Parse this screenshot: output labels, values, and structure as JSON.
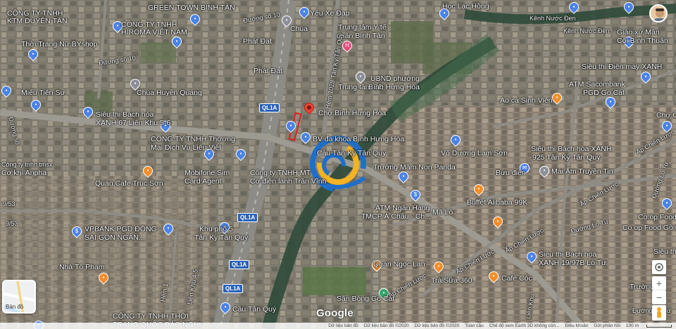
{
  "labels": {
    "green_town": "GREEN TOWN BÌNH TÂN",
    "cty_tnhh": "CÔNG TY TNHH",
    "ktm_duyen_tan": "KTM DUYÊN TÂN",
    "cty_tnhh_2": "CÔNG TY TNHH",
    "hiroma": "HIROMA VIỆT NAM",
    "thoi_trang": "Thời Trang Nữ BYshop",
    "duong_so_10a": "Đường số 10",
    "duong_so_10b": "Đường số 10",
    "yeu_xe_dap": "Yêu Xe Đạp",
    "chua": "Chùa",
    "trung_tam_yte": "Trung tâm Y tế",
    "quan_binh_tan": "quận Bình Tân",
    "phat_dat_1": "Phát Đạt",
    "phat_dat_2": "Phát Đạt",
    "hem_1028": "Hẻm 1028 Tân Kỳ Tân Quý",
    "trung_tam_bd": "Trung tâm BD",
    "ubnd": "UBND phường",
    "binh_hung_hoa": "Bình Hưng Hòa",
    "hoc_lac_hong": "Học Lạc Hồng",
    "kenh_nuoc_den_1": "Kênh Nước Đen",
    "kenh_nuoc_den_2": "Kênh Nước Đen",
    "giao_xu": "Giáo xứ Mân",
    "coi_binh_thuan": "Côi Bình Thuận",
    "mieu_tien_su": "Miếu Tiên Sư",
    "chua_huyen_quang": "Chùa Huyền Quang",
    "sieu_thi_dien_may": "Siêu thị Điện máy XANH",
    "atm_sacombank": "ATM Sacombank",
    "pgd_go_cat": "PGD Gò Cát",
    "ao_ca": "Ao cá Sinh Viên",
    "cho_binh_hung_hoa": "Chợ Bình Hưng Hòa",
    "sieu_thi_bhx_1": "Siêu thị Bách hóa",
    "xanh_67": "XANH 67 Liên Khu 5-6",
    "bv_binh_hung_hoa": "BV đa khoa Bình Hưng Hòa",
    "cau_tan_ky": "Cầu Tân Kỳ Tân Quý",
    "cty_thuong_mai": "CÔNG TY TNHH Thương",
    "mai_dich_vu": "Mại Dịch Vụ Liêu Việt",
    "vo_duong_lam_son": "Võ Dương Lam Sơn",
    "sieu_thi_bhx_2": "Siêu thị Bách hóa XANH",
    "bhx_925": "925 Tân Kỳ Tân Quý",
    "cty_tmsx": "Công ty tnhh tmsx",
    "co_khi_anpha": "Cơ khí Anpha",
    "truong_mam_non": "Trường Mầm Non Panda",
    "buu_dien": "Bưu điện",
    "mai_am": "Mái Ấm Truyền Tin",
    "mobifone": "Mobifone Sim",
    "card_agent": "Card Agent",
    "cty_mt": "Công ty TNHH MT",
    "co_dien_lanh": "Cơ điện lạnh Trần Vĩnh",
    "quan_cafe": "Quán Cafe Trúc Sơn",
    "buffet": "Buffet Alibaba 99K",
    "cho_o": "Chợ Ồ",
    "ap_chien_luoc_1": "Ấp Chiến Lược",
    "ap_chien_luoc_2": "Ấp Chiến Lược",
    "ap_chien_luoc_3": "Ấp Chiến Lược",
    "ap_chien_luoc_4": "Ấp Chiến Lược",
    "ap_chien_luoc_5": "Ấp Chiến Lược",
    "atm_ngan_hang": "ATM Ngân Hàng",
    "tmcp_a_chau": "TMCP Á Châu - Ch...",
    "ma_lo": "Mã Lò",
    "duong_lo_tu_1": "Đường Lò Tư",
    "duong_lo_tu_2": "Đường Lò Tư",
    "duong_lo_tu_3": "Đường Lò Tư",
    "coop_food": "Co.op Food",
    "coop_food_go_cat": "Co.op Food Gò Cát",
    "vpbank": "VPBANK PGD ĐÔNG",
    "sai_gon_ngan": "SÀI GÒN NGÂN...",
    "khu_pho_5": "Khu phố 5",
    "tan_ky_tan_quy": "Tân Kỳ Tân Quý",
    "nha_to_pham": "Nhà Tô Phạm",
    "quan_ngoc_lan": "Quán Ngọc Lan",
    "tra_sua_360": "Trà Sữa 360",
    "cafe_coc": "Cafe Cóc",
    "sieu_thi_bhx_3": "Siêu thị Bách hoá",
    "xanh_19": "XANH 19/97B Lò Tư",
    "sieu_thi_short": "Siêu thị",
    "truong_short": "Trường",
    "san_bong": "Sân Bóng Gò Cát",
    "cau_tan_quy": "Cầu Tân Quý",
    "cty_thoi_trang": "CÔNG TY TNHH THỜI",
    "trang_quoc": "TRANG QUỐC BẢO NGHI",
    "lien_khu": "Liên Khu",
    "duong_so_doc": "Đường số",
    "hem_1": "Hẻm 1",
    "lien_khu_45": "Liên Khu 4-5",
    "duong_9_53": "9/53",
    "duong_9_53b": "9/53"
  },
  "road_shields": [
    "QL1A",
    "QL1A",
    "QL1A",
    "QL1A"
  ],
  "controls": {
    "google": "Google",
    "thumb_label": "Bản đồ",
    "zoom_in": "+",
    "zoom_out": "−"
  },
  "footer": {
    "items": [
      "Dữ liệu bản đồ",
      "Dữ liệu bản đồ ©2020",
      "Dữ liệu bản đồ ©2020",
      "Toàn cầu",
      "Chế độ xem Earth 3D không còn...",
      "Điều khoản",
      "Gửi phản hồi",
      "100 m"
    ]
  },
  "colors": {
    "marker_red": "#e02020",
    "pin_red": "#ea4335",
    "logo_blue": "#1f6fc9",
    "logo_yellow": "#f4b323"
  }
}
